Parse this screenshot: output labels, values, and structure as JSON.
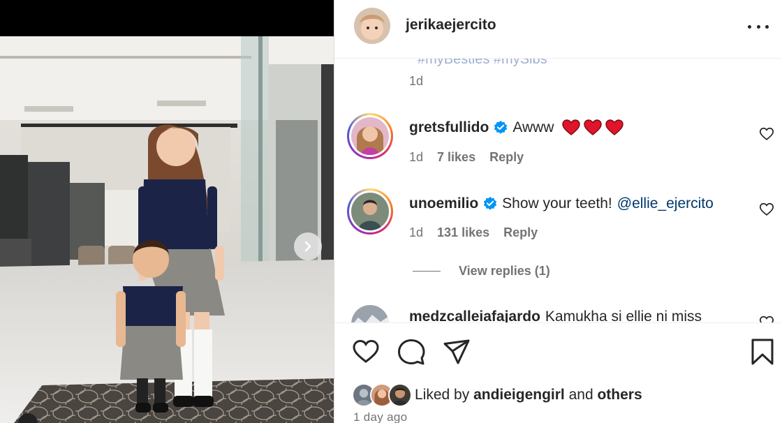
{
  "post": {
    "author": "jerikaejercito",
    "more_options_icon": "more-horizontal-icon",
    "caption_cut_text": "#myBesties  #mySibs",
    "caption_time": "1d",
    "time_ago": "1 day ago"
  },
  "comments": [
    {
      "username": "gretsfullido",
      "verified": true,
      "text": "Awww",
      "emoji": [
        "red-heart",
        "red-heart",
        "red-heart"
      ],
      "time": "1d",
      "likes": "7 likes",
      "reply": "Reply"
    },
    {
      "username": "unoemilio",
      "verified": true,
      "text": "Show your teeth!",
      "mention": "@ellie_ejercito",
      "time": "1d",
      "likes": "131 likes",
      "reply": "Reply",
      "view_replies": "View replies (1)"
    },
    {
      "username": "medzcalleiafajardo",
      "text": "Kamukha si ellie ni miss"
    }
  ],
  "actions": {
    "like_icon": "heart-outline-icon",
    "comment_icon": "comment-bubble-icon",
    "share_icon": "paper-plane-icon",
    "save_icon": "bookmark-icon"
  },
  "likes_summary": {
    "prefix": "Liked by",
    "user": "andieigengirl",
    "and": "and",
    "others": "others"
  },
  "colors": {
    "link": "#00376b",
    "verified": "#0095f6",
    "secondary_text": "#737373",
    "heart_emoji": "#e0142b"
  }
}
